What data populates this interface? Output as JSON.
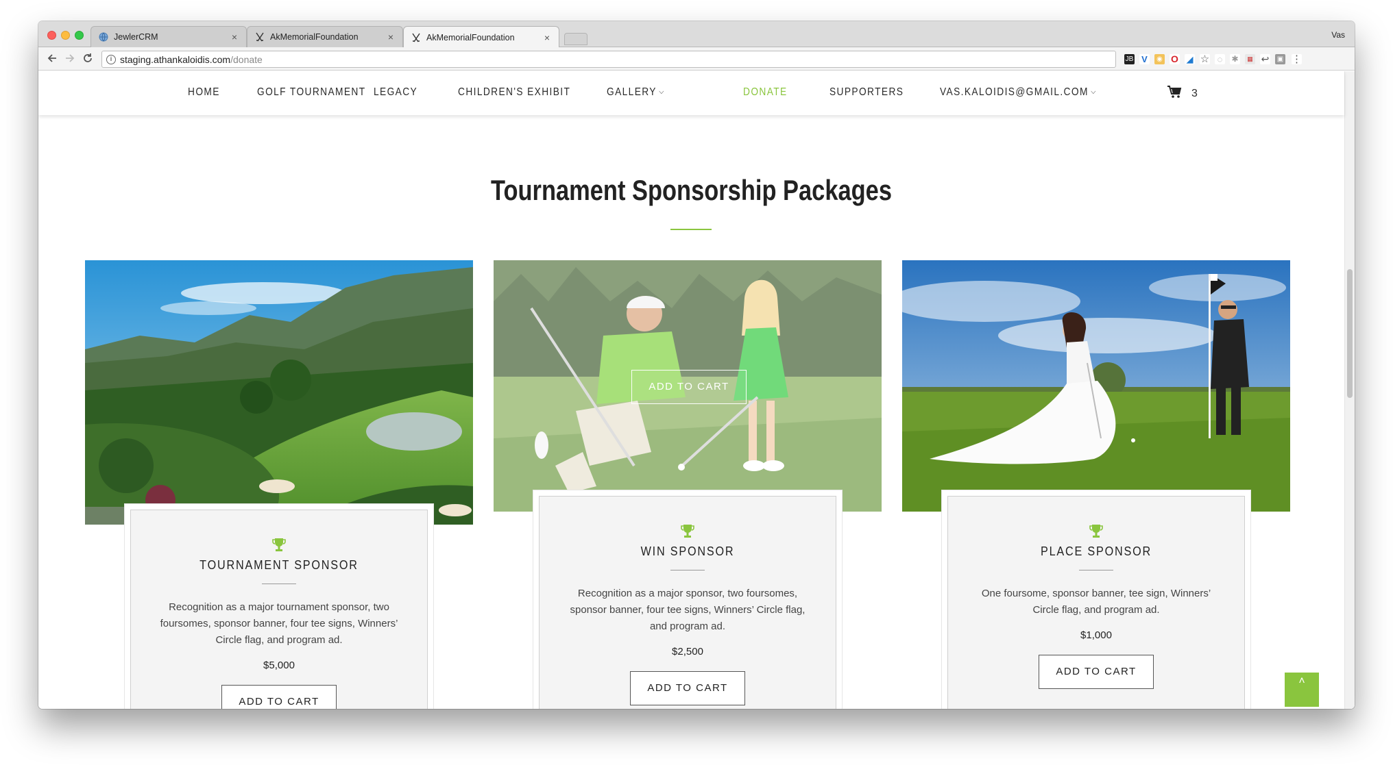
{
  "browser": {
    "tabs": [
      {
        "title": "JewlerCRM",
        "icon": "globe-icon",
        "active": false
      },
      {
        "title": "AkMemorialFoundation",
        "icon": "golf-clubs-icon",
        "active": false
      },
      {
        "title": "AkMemorialFoundation",
        "icon": "golf-clubs-icon",
        "active": true
      }
    ],
    "profile_name": "Vas",
    "url_host": "staging.athankaloidis.com",
    "url_path": "/donate",
    "tab_close": "×"
  },
  "site_nav": {
    "items": [
      {
        "label": "HOME",
        "active": false,
        "dropdown": false
      },
      {
        "label": "GOLF TOURNAMENT",
        "active": false,
        "dropdown": false
      },
      {
        "label": "LEGACY",
        "active": false,
        "dropdown": false
      },
      {
        "label": "CHILDREN'S EXHIBIT",
        "active": false,
        "dropdown": false
      },
      {
        "label": "GALLERY",
        "active": false,
        "dropdown": true
      },
      {
        "label": "DONATE",
        "active": true,
        "dropdown": false
      },
      {
        "label": "SUPPORTERS",
        "active": false,
        "dropdown": false
      },
      {
        "label": "VAS.KALOIDIS@GMAIL.COM",
        "active": false,
        "dropdown": true
      }
    ],
    "cart_count": "3",
    "accent_color": "#8ac53e"
  },
  "section": {
    "title": "Tournament Sponsorship Packages"
  },
  "packages": [
    {
      "name": "TOURNAMENT SPONSOR",
      "description": "Recognition as a major tournament sponsor, two foursomes, sponsor banner, four tee signs, Winners’ Circle flag, and program ad.",
      "price": "$5,000",
      "button": "ADD TO CART",
      "image": "golf-course-mountains"
    },
    {
      "name": "WIN SPONSOR",
      "description": "Recognition as a major sponsor, two foursomes, sponsor banner, four tee signs, Winners’ Circle flag, and program ad.",
      "price": "$2,500",
      "button": "ADD TO CART",
      "hover_button": "ADD TO CART",
      "image": "father-daughter-golf"
    },
    {
      "name": "PLACE SPONSOR",
      "description": "One foursome, sponsor banner, tee sign, Winners’ Circle flag, and program ad.",
      "price": "$1,000",
      "button": "ADD TO CART",
      "image": "wedding-couple-golf"
    }
  ],
  "back_to_top": "˄"
}
